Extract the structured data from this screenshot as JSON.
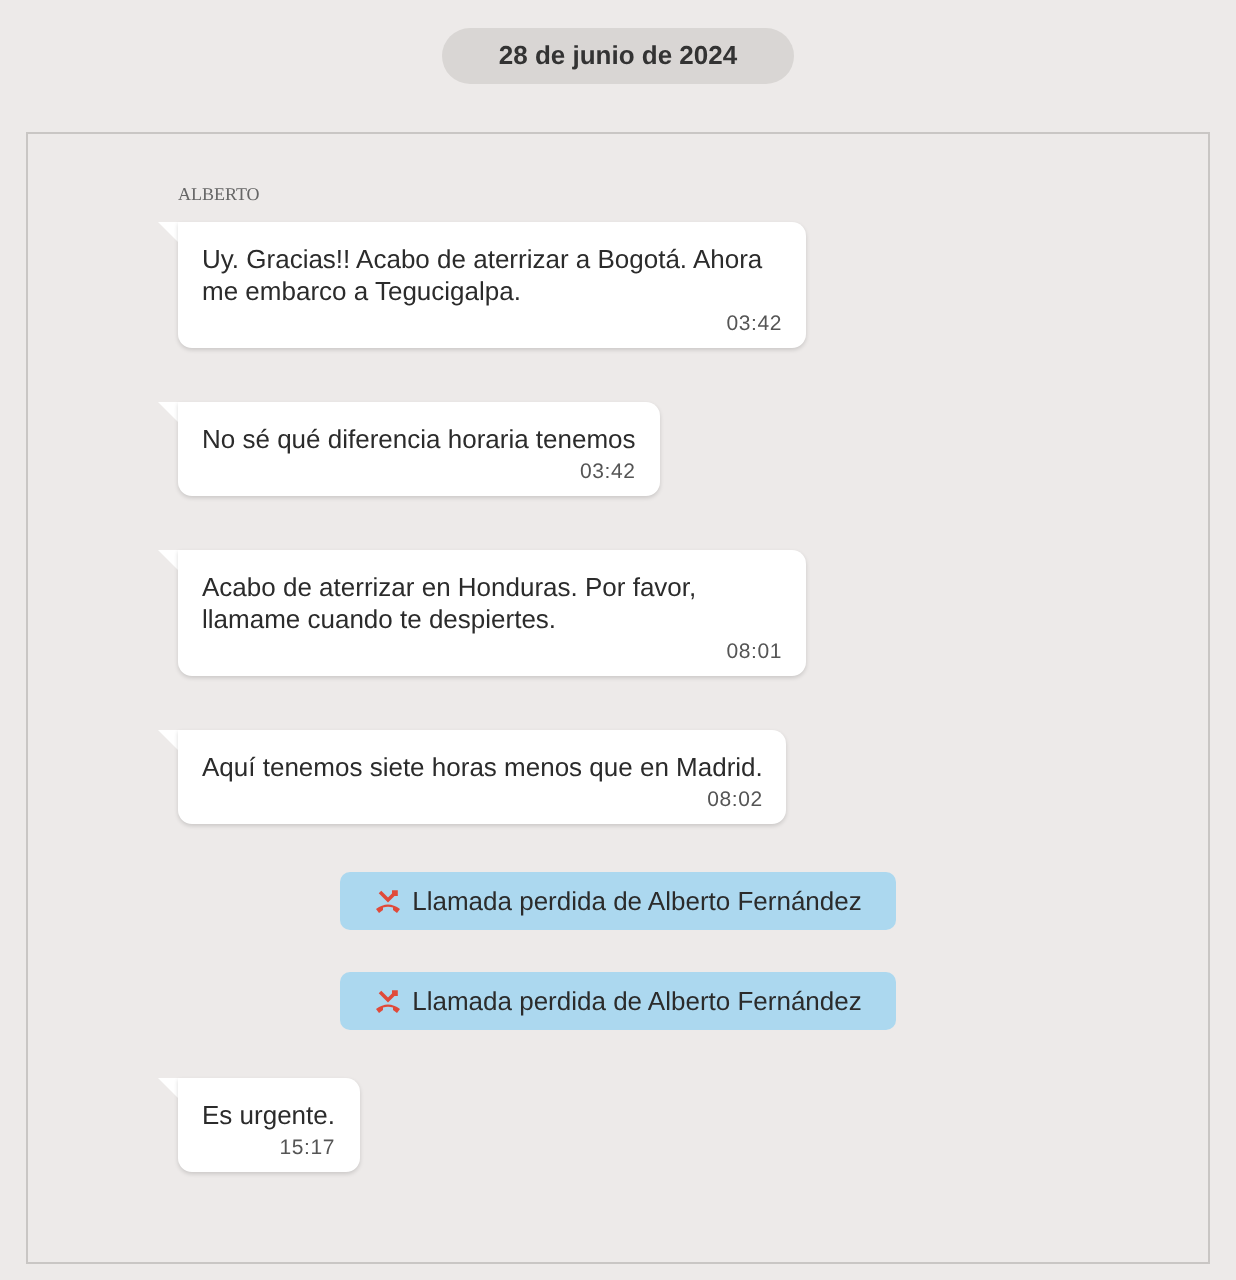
{
  "date": "28 de junio de 2024",
  "sender": "ALBERTO",
  "messages": [
    {
      "kind": "message",
      "text": "Uy. Gracias!! Acabo de aterrizar a Bogotá. Ahora me embarco a Tegucigalpa.",
      "time": "03:42"
    },
    {
      "kind": "message",
      "text": "No sé qué diferencia horaria tenemos",
      "time": "03:42"
    },
    {
      "kind": "message",
      "text": "Acabo de aterrizar en Honduras. Por favor, llamame cuando te despiertes.",
      "time": "08:01"
    },
    {
      "kind": "message",
      "text": "Aquí tenemos siete horas menos que en Madrid.",
      "time": "08:02"
    },
    {
      "kind": "missed_call",
      "text": "Llamada perdida de Alberto Fernández"
    },
    {
      "kind": "missed_call",
      "text": "Llamada perdida de Alberto Fernández"
    },
    {
      "kind": "message",
      "text": "Es urgente.",
      "time": "15:17"
    }
  ]
}
